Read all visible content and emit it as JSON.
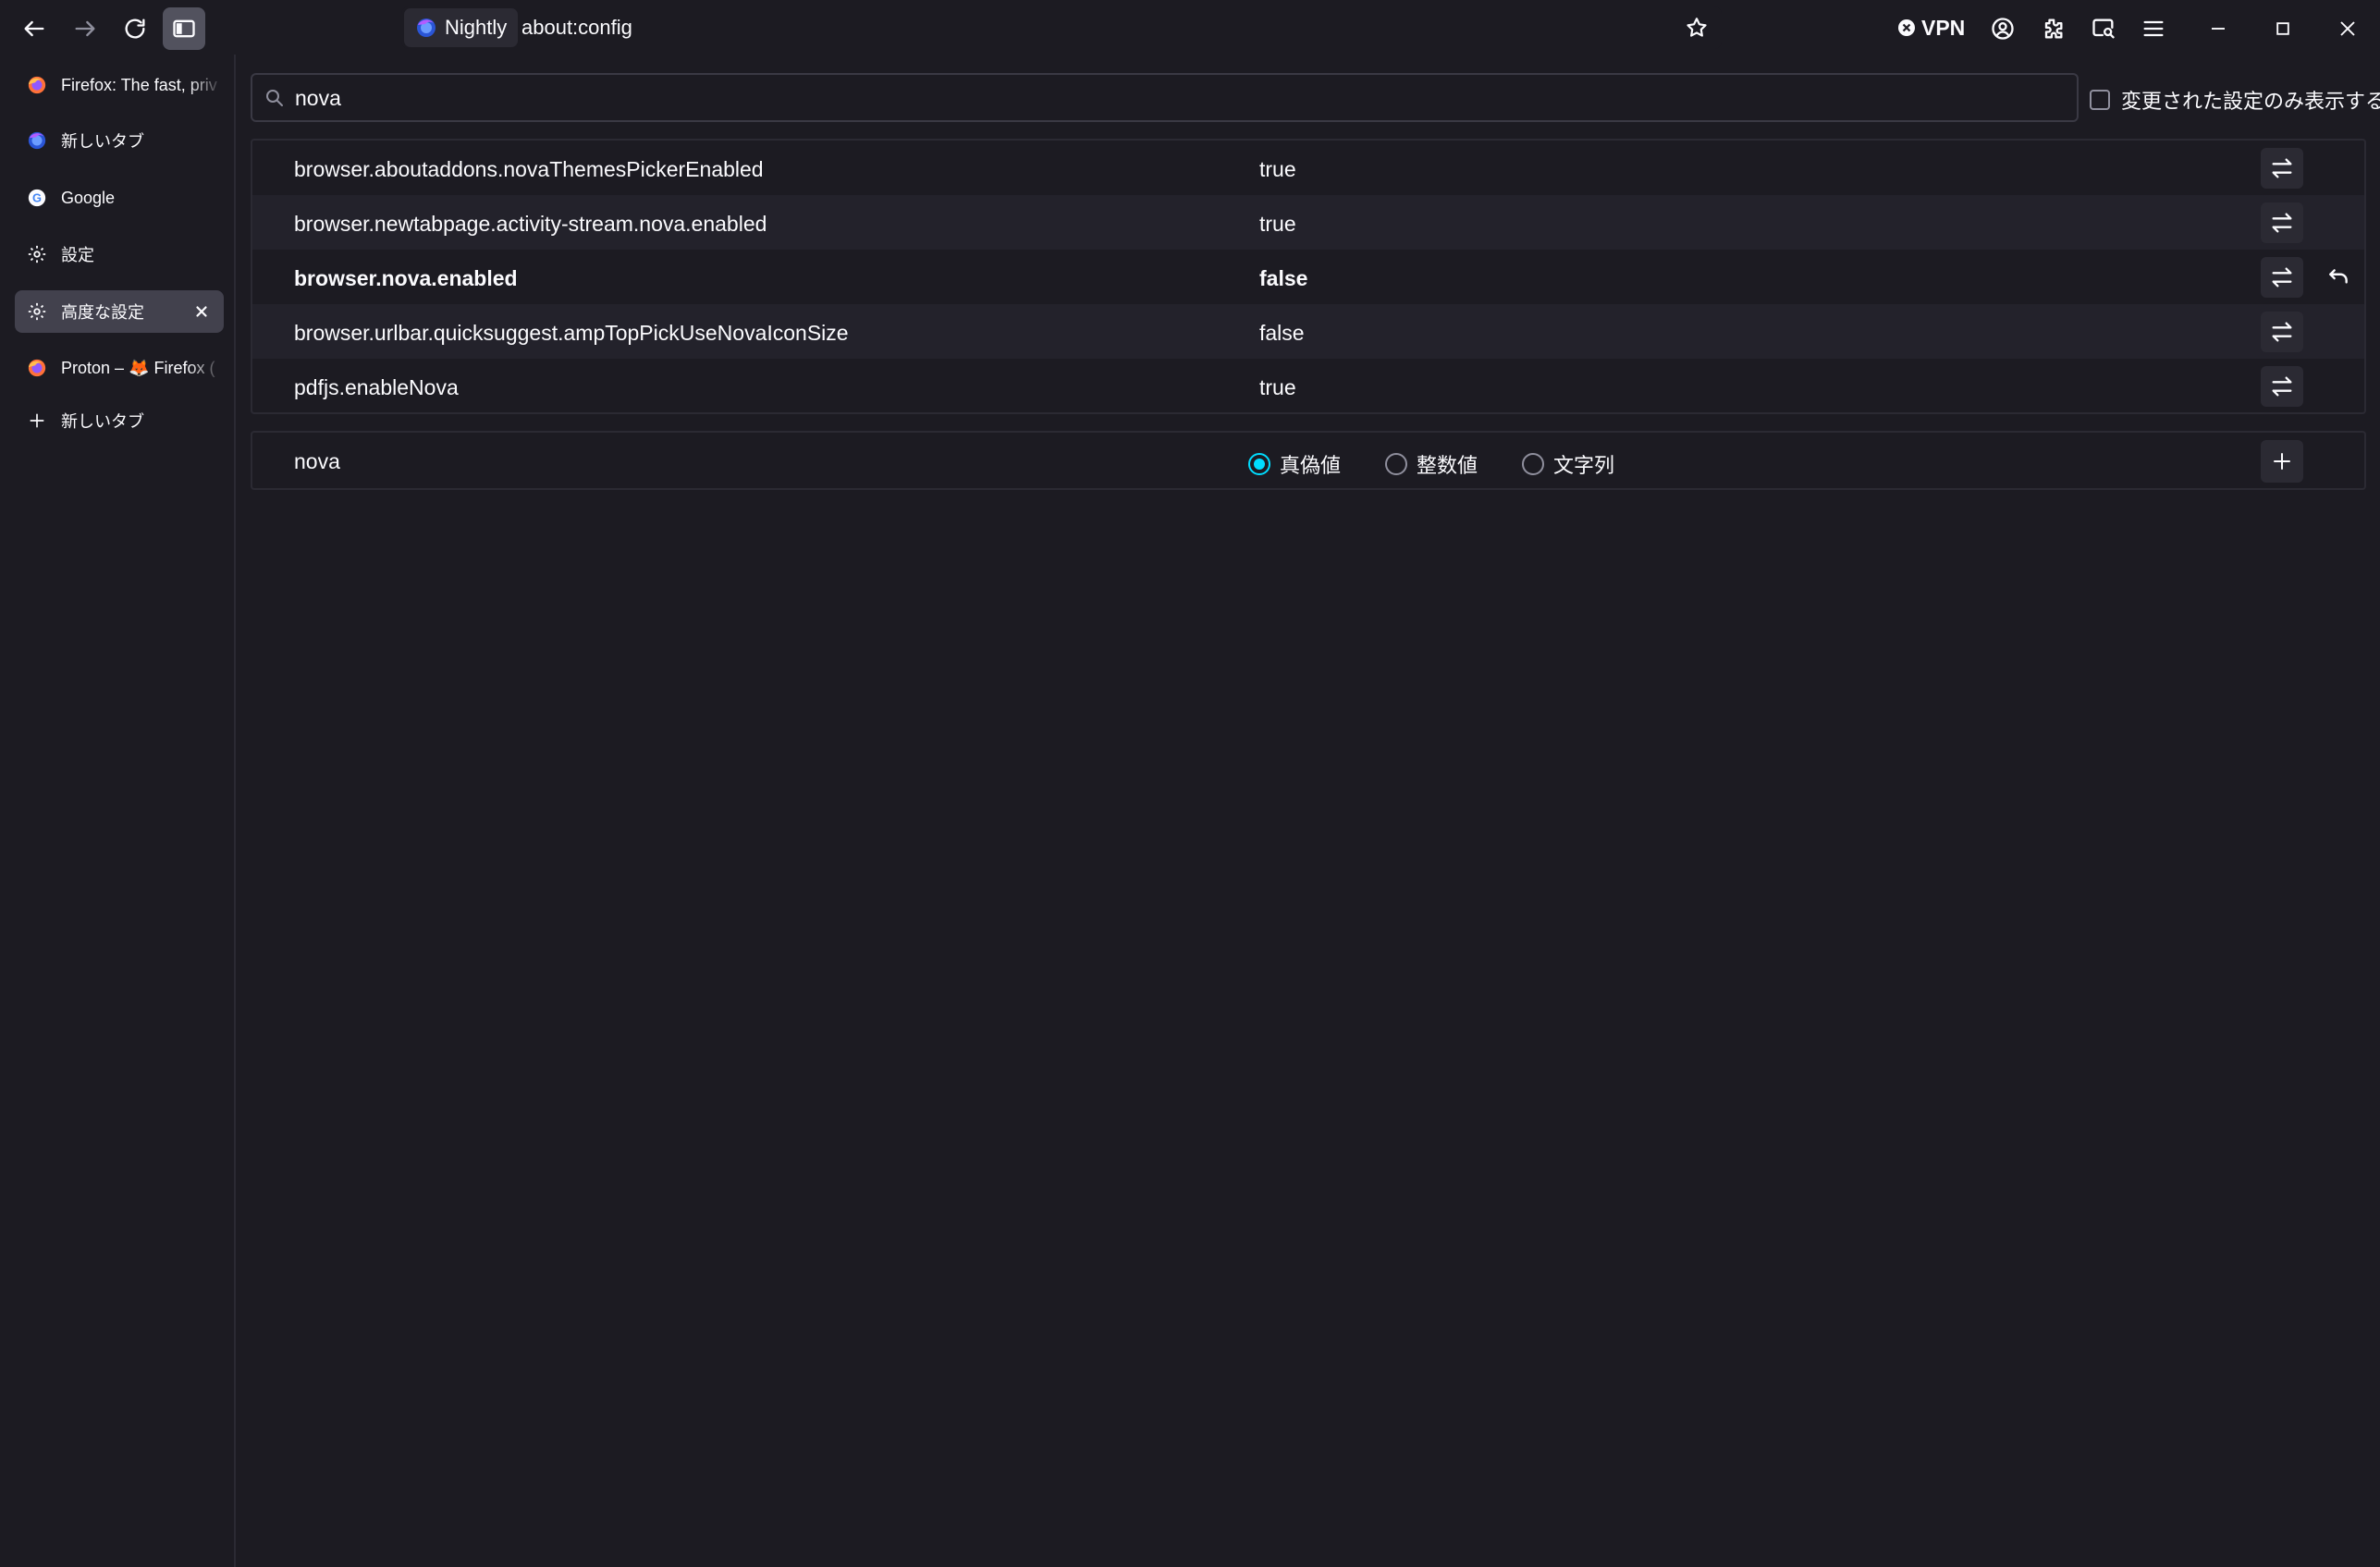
{
  "toolbar": {
    "identity_label": "Nightly",
    "url": "about:config",
    "vpn_label": "VPN"
  },
  "sidebar": {
    "tabs": [
      {
        "label": "Firefox: The fast, priv",
        "icon": "firefox-icon"
      },
      {
        "label": "新しいタブ",
        "icon": "nightly-icon"
      },
      {
        "label": "Google",
        "icon": "google-icon"
      },
      {
        "label": "設定",
        "icon": "gear-icon"
      },
      {
        "label": "高度な設定",
        "icon": "gear-icon",
        "active": true
      },
      {
        "label": "Proton – 🦊 Firefox (",
        "icon": "firefox-icon"
      }
    ],
    "new_tab_label": "新しいタブ"
  },
  "search": {
    "value": "nova"
  },
  "show_modified_label": "変更された設定のみ表示する",
  "prefs": [
    {
      "name": "browser.aboutaddons.novaThemesPickerEnabled",
      "value": "true",
      "modified": false
    },
    {
      "name": "browser.newtabpage.activity-stream.nova.enabled",
      "value": "true",
      "modified": false
    },
    {
      "name": "browser.nova.enabled",
      "value": "false",
      "modified": true
    },
    {
      "name": "browser.urlbar.quicksuggest.ampTopPickUseNovaIconSize",
      "value": "false",
      "modified": false
    },
    {
      "name": "pdfjs.enableNova",
      "value": "true",
      "modified": false
    }
  ],
  "add_row": {
    "name": "nova",
    "types": [
      "真偽値",
      "整数値",
      "文字列"
    ],
    "selected_type": "真偽値"
  },
  "colors": {
    "background": "#1c1b22",
    "accent": "#00ddff",
    "row_alt": "#23222b"
  }
}
